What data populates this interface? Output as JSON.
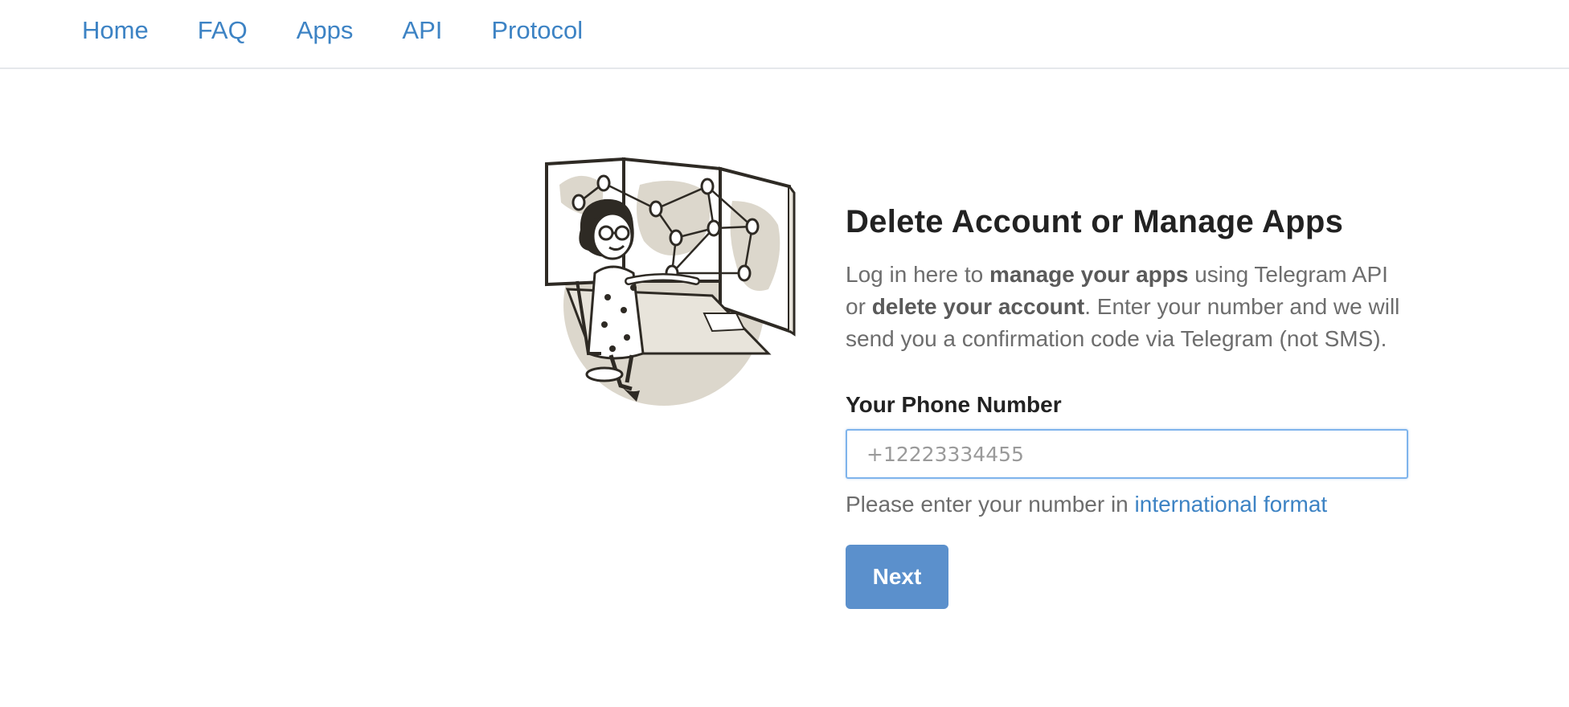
{
  "nav": {
    "items": [
      {
        "label": "Home"
      },
      {
        "label": "FAQ"
      },
      {
        "label": "Apps"
      },
      {
        "label": "API"
      },
      {
        "label": "Protocol"
      }
    ]
  },
  "main": {
    "title": "Delete Account or Manage Apps",
    "description": {
      "part1": "Log in here to ",
      "bold1": "manage your apps",
      "part2": " using Telegram API or ",
      "bold2": "delete your account",
      "part3": ". Enter your number and we will send you a confirmation code via Telegram (not SMS)."
    },
    "phone_label": "Your Phone Number",
    "phone_placeholder": "+12223334455",
    "phone_value": "",
    "hint_text": "Please enter your number in ",
    "hint_link": "international format",
    "next_label": "Next"
  },
  "colors": {
    "link": "#3d83c4",
    "button": "#5b90cc",
    "input_focus": "#7fb4ec",
    "illustration_fill": "#dcd7cc"
  }
}
